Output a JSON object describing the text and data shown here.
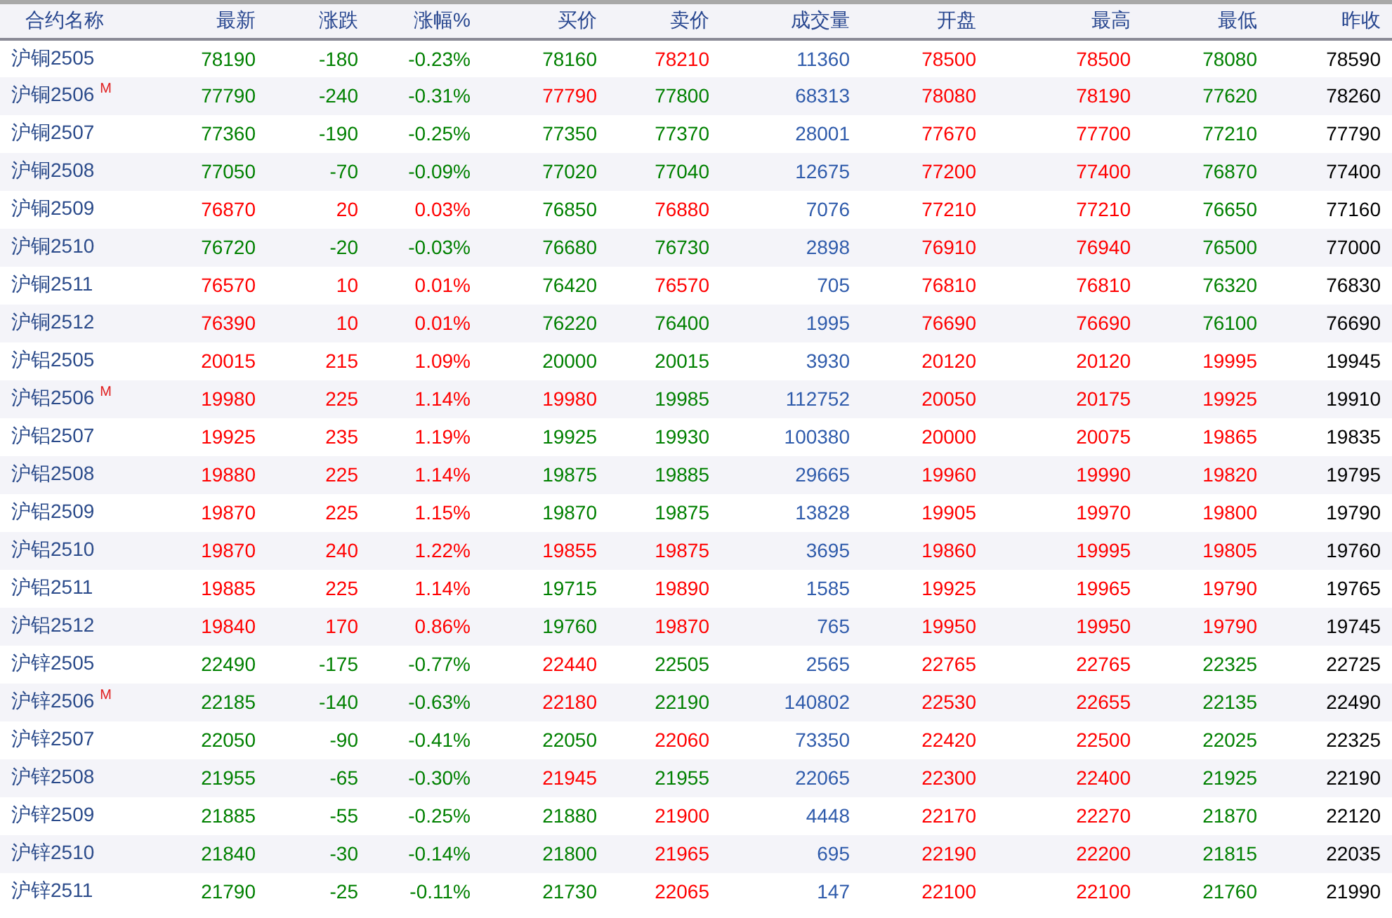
{
  "table": {
    "columns": [
      "合约名称",
      "最新",
      "涨跌",
      "涨幅%",
      "买价",
      "卖价",
      "成交量",
      "开盘",
      "最高",
      "最低",
      "昨收"
    ],
    "rows": [
      {
        "cells": [
          {
            "text": "沪铜2505"
          },
          {
            "text": "78190",
            "color": "#008000"
          },
          {
            "text": "-180",
            "color": "#008000"
          },
          {
            "text": "-0.23%",
            "color": "#008000"
          },
          {
            "text": "78160",
            "color": "#008000"
          },
          {
            "text": "78210",
            "color": "#ff0000"
          },
          {
            "text": "11360"
          },
          {
            "text": "78500",
            "color": "#ff0000"
          },
          {
            "text": "78500",
            "color": "#ff0000"
          },
          {
            "text": "78080",
            "color": "#008000"
          },
          {
            "text": "78590"
          }
        ]
      },
      {
        "cells": [
          {
            "text": "沪铜2506",
            "mark": "M"
          },
          {
            "text": "77790",
            "color": "#008000"
          },
          {
            "text": "-240",
            "color": "#008000"
          },
          {
            "text": "-0.31%",
            "color": "#008000"
          },
          {
            "text": "77790",
            "color": "#ff0000"
          },
          {
            "text": "77800",
            "color": "#008000"
          },
          {
            "text": "68313"
          },
          {
            "text": "78080",
            "color": "#ff0000"
          },
          {
            "text": "78190",
            "color": "#ff0000"
          },
          {
            "text": "77620",
            "color": "#008000"
          },
          {
            "text": "78260"
          }
        ]
      },
      {
        "cells": [
          {
            "text": "沪铜2507"
          },
          {
            "text": "77360",
            "color": "#008000"
          },
          {
            "text": "-190",
            "color": "#008000"
          },
          {
            "text": "-0.25%",
            "color": "#008000"
          },
          {
            "text": "77350",
            "color": "#008000"
          },
          {
            "text": "77370",
            "color": "#008000"
          },
          {
            "text": "28001"
          },
          {
            "text": "77670",
            "color": "#ff0000"
          },
          {
            "text": "77700",
            "color": "#ff0000"
          },
          {
            "text": "77210",
            "color": "#008000"
          },
          {
            "text": "77790"
          }
        ]
      },
      {
        "cells": [
          {
            "text": "沪铜2508"
          },
          {
            "text": "77050",
            "color": "#008000"
          },
          {
            "text": "-70",
            "color": "#008000"
          },
          {
            "text": "-0.09%",
            "color": "#008000"
          },
          {
            "text": "77020",
            "color": "#008000"
          },
          {
            "text": "77040",
            "color": "#008000"
          },
          {
            "text": "12675"
          },
          {
            "text": "77200",
            "color": "#ff0000"
          },
          {
            "text": "77400",
            "color": "#ff0000"
          },
          {
            "text": "76870",
            "color": "#008000"
          },
          {
            "text": "77400"
          }
        ]
      },
      {
        "cells": [
          {
            "text": "沪铜2509"
          },
          {
            "text": "76870",
            "color": "#ff0000"
          },
          {
            "text": "20",
            "color": "#ff0000"
          },
          {
            "text": "0.03%",
            "color": "#ff0000"
          },
          {
            "text": "76850",
            "color": "#008000"
          },
          {
            "text": "76880",
            "color": "#ff0000"
          },
          {
            "text": "7076"
          },
          {
            "text": "77210",
            "color": "#ff0000"
          },
          {
            "text": "77210",
            "color": "#ff0000"
          },
          {
            "text": "76650",
            "color": "#008000"
          },
          {
            "text": "77160"
          }
        ]
      },
      {
        "cells": [
          {
            "text": "沪铜2510"
          },
          {
            "text": "76720",
            "color": "#008000"
          },
          {
            "text": "-20",
            "color": "#008000"
          },
          {
            "text": "-0.03%",
            "color": "#008000"
          },
          {
            "text": "76680",
            "color": "#008000"
          },
          {
            "text": "76730",
            "color": "#008000"
          },
          {
            "text": "2898"
          },
          {
            "text": "76910",
            "color": "#ff0000"
          },
          {
            "text": "76940",
            "color": "#ff0000"
          },
          {
            "text": "76500",
            "color": "#008000"
          },
          {
            "text": "77000"
          }
        ]
      },
      {
        "cells": [
          {
            "text": "沪铜2511"
          },
          {
            "text": "76570",
            "color": "#ff0000"
          },
          {
            "text": "10",
            "color": "#ff0000"
          },
          {
            "text": "0.01%",
            "color": "#ff0000"
          },
          {
            "text": "76420",
            "color": "#008000"
          },
          {
            "text": "76570",
            "color": "#ff0000"
          },
          {
            "text": "705"
          },
          {
            "text": "76810",
            "color": "#ff0000"
          },
          {
            "text": "76810",
            "color": "#ff0000"
          },
          {
            "text": "76320",
            "color": "#008000"
          },
          {
            "text": "76830"
          }
        ]
      },
      {
        "cells": [
          {
            "text": "沪铜2512"
          },
          {
            "text": "76390",
            "color": "#ff0000"
          },
          {
            "text": "10",
            "color": "#ff0000"
          },
          {
            "text": "0.01%",
            "color": "#ff0000"
          },
          {
            "text": "76220",
            "color": "#008000"
          },
          {
            "text": "76400",
            "color": "#008000"
          },
          {
            "text": "1995"
          },
          {
            "text": "76690",
            "color": "#ff0000"
          },
          {
            "text": "76690",
            "color": "#ff0000"
          },
          {
            "text": "76100",
            "color": "#008000"
          },
          {
            "text": "76690"
          }
        ]
      },
      {
        "cells": [
          {
            "text": "沪铝2505"
          },
          {
            "text": "20015",
            "color": "#ff0000"
          },
          {
            "text": "215",
            "color": "#ff0000"
          },
          {
            "text": "1.09%",
            "color": "#ff0000"
          },
          {
            "text": "20000",
            "color": "#008000"
          },
          {
            "text": "20015",
            "color": "#008000"
          },
          {
            "text": "3930"
          },
          {
            "text": "20120",
            "color": "#ff0000"
          },
          {
            "text": "20120",
            "color": "#ff0000"
          },
          {
            "text": "19995",
            "color": "#ff0000"
          },
          {
            "text": "19945"
          }
        ]
      },
      {
        "cells": [
          {
            "text": "沪铝2506",
            "mark": "M"
          },
          {
            "text": "19980",
            "color": "#ff0000"
          },
          {
            "text": "225",
            "color": "#ff0000"
          },
          {
            "text": "1.14%",
            "color": "#ff0000"
          },
          {
            "text": "19980",
            "color": "#ff0000"
          },
          {
            "text": "19985",
            "color": "#008000"
          },
          {
            "text": "112752"
          },
          {
            "text": "20050",
            "color": "#ff0000"
          },
          {
            "text": "20175",
            "color": "#ff0000"
          },
          {
            "text": "19925",
            "color": "#ff0000"
          },
          {
            "text": "19910"
          }
        ]
      },
      {
        "cells": [
          {
            "text": "沪铝2507"
          },
          {
            "text": "19925",
            "color": "#ff0000"
          },
          {
            "text": "235",
            "color": "#ff0000"
          },
          {
            "text": "1.19%",
            "color": "#ff0000"
          },
          {
            "text": "19925",
            "color": "#008000"
          },
          {
            "text": "19930",
            "color": "#008000"
          },
          {
            "text": "100380"
          },
          {
            "text": "20000",
            "color": "#ff0000"
          },
          {
            "text": "20075",
            "color": "#ff0000"
          },
          {
            "text": "19865",
            "color": "#ff0000"
          },
          {
            "text": "19835"
          }
        ]
      },
      {
        "cells": [
          {
            "text": "沪铝2508"
          },
          {
            "text": "19880",
            "color": "#ff0000"
          },
          {
            "text": "225",
            "color": "#ff0000"
          },
          {
            "text": "1.14%",
            "color": "#ff0000"
          },
          {
            "text": "19875",
            "color": "#008000"
          },
          {
            "text": "19885",
            "color": "#008000"
          },
          {
            "text": "29665"
          },
          {
            "text": "19960",
            "color": "#ff0000"
          },
          {
            "text": "19990",
            "color": "#ff0000"
          },
          {
            "text": "19820",
            "color": "#ff0000"
          },
          {
            "text": "19795"
          }
        ]
      },
      {
        "cells": [
          {
            "text": "沪铝2509"
          },
          {
            "text": "19870",
            "color": "#ff0000"
          },
          {
            "text": "225",
            "color": "#ff0000"
          },
          {
            "text": "1.15%",
            "color": "#ff0000"
          },
          {
            "text": "19870",
            "color": "#008000"
          },
          {
            "text": "19875",
            "color": "#008000"
          },
          {
            "text": "13828"
          },
          {
            "text": "19905",
            "color": "#ff0000"
          },
          {
            "text": "19970",
            "color": "#ff0000"
          },
          {
            "text": "19800",
            "color": "#ff0000"
          },
          {
            "text": "19790"
          }
        ]
      },
      {
        "cells": [
          {
            "text": "沪铝2510"
          },
          {
            "text": "19870",
            "color": "#ff0000"
          },
          {
            "text": "240",
            "color": "#ff0000"
          },
          {
            "text": "1.22%",
            "color": "#ff0000"
          },
          {
            "text": "19855",
            "color": "#ff0000"
          },
          {
            "text": "19875",
            "color": "#ff0000"
          },
          {
            "text": "3695"
          },
          {
            "text": "19860",
            "color": "#ff0000"
          },
          {
            "text": "19995",
            "color": "#ff0000"
          },
          {
            "text": "19805",
            "color": "#ff0000"
          },
          {
            "text": "19760"
          }
        ]
      },
      {
        "cells": [
          {
            "text": "沪铝2511"
          },
          {
            "text": "19885",
            "color": "#ff0000"
          },
          {
            "text": "225",
            "color": "#ff0000"
          },
          {
            "text": "1.14%",
            "color": "#ff0000"
          },
          {
            "text": "19715",
            "color": "#008000"
          },
          {
            "text": "19890",
            "color": "#ff0000"
          },
          {
            "text": "1585"
          },
          {
            "text": "19925",
            "color": "#ff0000"
          },
          {
            "text": "19965",
            "color": "#ff0000"
          },
          {
            "text": "19790",
            "color": "#ff0000"
          },
          {
            "text": "19765"
          }
        ]
      },
      {
        "cells": [
          {
            "text": "沪铝2512"
          },
          {
            "text": "19840",
            "color": "#ff0000"
          },
          {
            "text": "170",
            "color": "#ff0000"
          },
          {
            "text": "0.86%",
            "color": "#ff0000"
          },
          {
            "text": "19760",
            "color": "#008000"
          },
          {
            "text": "19870",
            "color": "#ff0000"
          },
          {
            "text": "765"
          },
          {
            "text": "19950",
            "color": "#ff0000"
          },
          {
            "text": "19950",
            "color": "#ff0000"
          },
          {
            "text": "19790",
            "color": "#ff0000"
          },
          {
            "text": "19745"
          }
        ]
      },
      {
        "cells": [
          {
            "text": "沪锌2505"
          },
          {
            "text": "22490",
            "color": "#008000"
          },
          {
            "text": "-175",
            "color": "#008000"
          },
          {
            "text": "-0.77%",
            "color": "#008000"
          },
          {
            "text": "22440",
            "color": "#ff0000"
          },
          {
            "text": "22505",
            "color": "#008000"
          },
          {
            "text": "2565"
          },
          {
            "text": "22765",
            "color": "#ff0000"
          },
          {
            "text": "22765",
            "color": "#ff0000"
          },
          {
            "text": "22325",
            "color": "#008000"
          },
          {
            "text": "22725"
          }
        ]
      },
      {
        "cells": [
          {
            "text": "沪锌2506",
            "mark": "M"
          },
          {
            "text": "22185",
            "color": "#008000"
          },
          {
            "text": "-140",
            "color": "#008000"
          },
          {
            "text": "-0.63%",
            "color": "#008000"
          },
          {
            "text": "22180",
            "color": "#ff0000"
          },
          {
            "text": "22190",
            "color": "#008000"
          },
          {
            "text": "140802"
          },
          {
            "text": "22530",
            "color": "#ff0000"
          },
          {
            "text": "22655",
            "color": "#ff0000"
          },
          {
            "text": "22135",
            "color": "#008000"
          },
          {
            "text": "22490"
          }
        ]
      },
      {
        "cells": [
          {
            "text": "沪锌2507"
          },
          {
            "text": "22050",
            "color": "#008000"
          },
          {
            "text": "-90",
            "color": "#008000"
          },
          {
            "text": "-0.41%",
            "color": "#008000"
          },
          {
            "text": "22050",
            "color": "#008000"
          },
          {
            "text": "22060",
            "color": "#ff0000"
          },
          {
            "text": "73350"
          },
          {
            "text": "22420",
            "color": "#ff0000"
          },
          {
            "text": "22500",
            "color": "#ff0000"
          },
          {
            "text": "22025",
            "color": "#008000"
          },
          {
            "text": "22325"
          }
        ]
      },
      {
        "cells": [
          {
            "text": "沪锌2508"
          },
          {
            "text": "21955",
            "color": "#008000"
          },
          {
            "text": "-65",
            "color": "#008000"
          },
          {
            "text": "-0.30%",
            "color": "#008000"
          },
          {
            "text": "21945",
            "color": "#ff0000"
          },
          {
            "text": "21955",
            "color": "#008000"
          },
          {
            "text": "22065"
          },
          {
            "text": "22300",
            "color": "#ff0000"
          },
          {
            "text": "22400",
            "color": "#ff0000"
          },
          {
            "text": "21925",
            "color": "#008000"
          },
          {
            "text": "22190"
          }
        ]
      },
      {
        "cells": [
          {
            "text": "沪锌2509"
          },
          {
            "text": "21885",
            "color": "#008000"
          },
          {
            "text": "-55",
            "color": "#008000"
          },
          {
            "text": "-0.25%",
            "color": "#008000"
          },
          {
            "text": "21880",
            "color": "#008000"
          },
          {
            "text": "21900",
            "color": "#ff0000"
          },
          {
            "text": "4448"
          },
          {
            "text": "22170",
            "color": "#ff0000"
          },
          {
            "text": "22270",
            "color": "#ff0000"
          },
          {
            "text": "21870",
            "color": "#008000"
          },
          {
            "text": "22120"
          }
        ]
      },
      {
        "cells": [
          {
            "text": "沪锌2510"
          },
          {
            "text": "21840",
            "color": "#008000"
          },
          {
            "text": "-30",
            "color": "#008000"
          },
          {
            "text": "-0.14%",
            "color": "#008000"
          },
          {
            "text": "21800",
            "color": "#008000"
          },
          {
            "text": "21965",
            "color": "#ff0000"
          },
          {
            "text": "695"
          },
          {
            "text": "22190",
            "color": "#ff0000"
          },
          {
            "text": "22200",
            "color": "#ff0000"
          },
          {
            "text": "21815",
            "color": "#008000"
          },
          {
            "text": "22035"
          }
        ]
      },
      {
        "cells": [
          {
            "text": "沪锌2511"
          },
          {
            "text": "21790",
            "color": "#008000"
          },
          {
            "text": "-25",
            "color": "#008000"
          },
          {
            "text": "-0.11%",
            "color": "#008000"
          },
          {
            "text": "21730",
            "color": "#008000"
          },
          {
            "text": "22065",
            "color": "#ff0000"
          },
          {
            "text": "147"
          },
          {
            "text": "22100",
            "color": "#ff0000"
          },
          {
            "text": "22100",
            "color": "#ff0000"
          },
          {
            "text": "21760",
            "color": "#008000"
          },
          {
            "text": "21990"
          }
        ]
      }
    ]
  }
}
